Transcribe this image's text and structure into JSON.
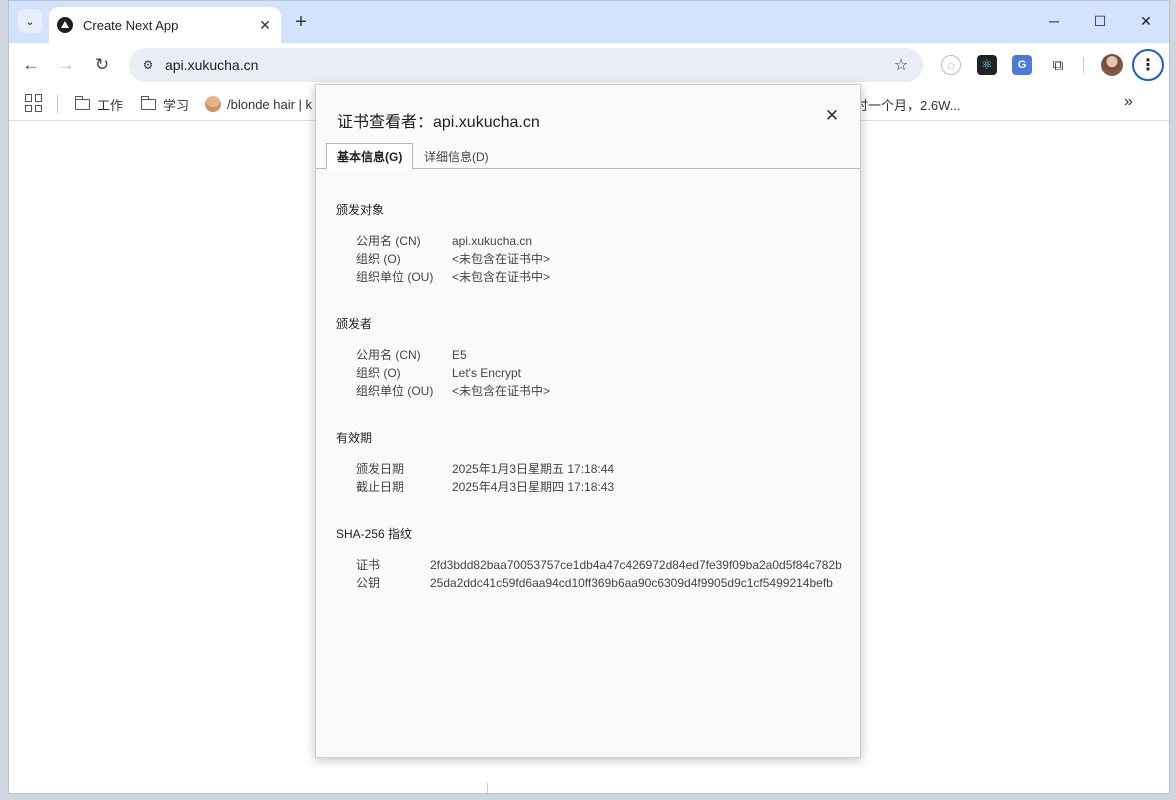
{
  "tab": {
    "title": "Create Next App",
    "close_glyph": "✕"
  },
  "toolbar": {
    "url": "api.xukucha.cn"
  },
  "bookmarks": [
    {
      "label": "工作",
      "kind": "folder"
    },
    {
      "label": "学习",
      "kind": "folder"
    },
    {
      "label": "/blonde hair | k",
      "kind": "link"
    },
    {
      "label": "时一个月，2.6W...",
      "kind": "link"
    }
  ],
  "dialog": {
    "title": "证书查看者：api.xukucha.cn",
    "tabs": {
      "general": "基本信息(G)",
      "details": "详细信息(D)"
    },
    "issued_to": {
      "heading": "颁发对象",
      "rows": [
        {
          "key": "公用名 (CN)",
          "value": "api.xukucha.cn"
        },
        {
          "key": "组织 (O)",
          "value": "<未包含在证书中>"
        },
        {
          "key": "组织单位 (OU)",
          "value": "<未包含在证书中>"
        }
      ]
    },
    "issued_by": {
      "heading": "颁发者",
      "rows": [
        {
          "key": "公用名 (CN)",
          "value": "E5"
        },
        {
          "key": "组织 (O)",
          "value": "Let's Encrypt"
        },
        {
          "key": "组织单位 (OU)",
          "value": "<未包含在证书中>"
        }
      ]
    },
    "validity": {
      "heading": "有效期",
      "rows": [
        {
          "key": "颁发日期",
          "value": "2025年1月3日星期五 17:18:44"
        },
        {
          "key": "截止日期",
          "value": "2025年4月3日星期四 17:18:43"
        }
      ]
    },
    "fingerprints": {
      "heading": "SHA-256 指纹",
      "rows": [
        {
          "key": "证书",
          "value": "2fd3bdd82baa70053757ce1db4a47c426972d84ed7fe39f09ba2a0d5f84c782b"
        },
        {
          "key": "公钥",
          "value": "25da2ddc41c59fd6aa94cd10ff369b6aa90c6309d4f9905d9c1cf5499214befb"
        }
      ]
    }
  },
  "icons": {
    "tab_search": "chevron-down-icon",
    "new_tab": "plus-icon",
    "back": "arrow-left-icon",
    "forward": "arrow-right-icon",
    "reload": "reload-icon",
    "site_info": "tune-icon",
    "bookmark_star": "star-icon",
    "menu": "more-vertical-icon"
  },
  "colors": {
    "tabstrip": "#d3e3fd",
    "omnibox": "#e9eef6",
    "focus_ring": "#1a5bd6"
  }
}
